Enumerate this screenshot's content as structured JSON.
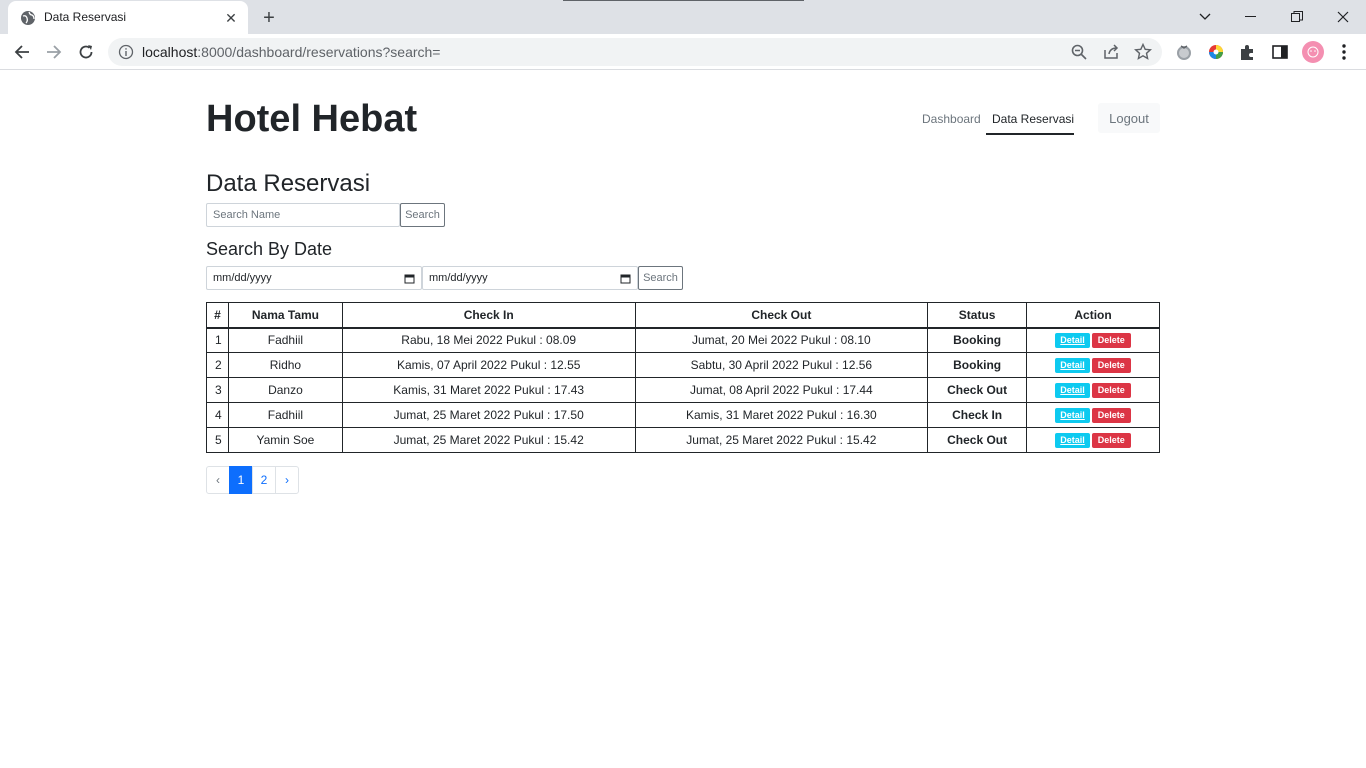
{
  "browser": {
    "tab_title": "Data Reservasi",
    "url_host": "localhost",
    "url_path": ":8000/dashboard/reservations?search="
  },
  "page": {
    "brand": "Hotel Hebat",
    "nav": {
      "dashboard": "Dashboard",
      "reservations": "Data Reservasi",
      "logout": "Logout"
    },
    "heading": "Data Reservasi",
    "search": {
      "placeholder": "Search Name",
      "button": "Search"
    },
    "date_heading": "Search By Date",
    "date_search": {
      "from_placeholder": "mm/dd/yyyy",
      "to_placeholder": "mm/dd/yyyy",
      "button": "Search"
    },
    "table": {
      "headers": [
        "#",
        "Nama Tamu",
        "Check In",
        "Check Out",
        "Status",
        "Action"
      ],
      "rows": [
        {
          "no": "1",
          "name": "Fadhiil",
          "check_in": "Rabu, 18 Mei 2022 Pukul : 08.09",
          "check_out": "Jumat, 20 Mei 2022 Pukul : 08.10",
          "status": "Booking"
        },
        {
          "no": "2",
          "name": "Ridho",
          "check_in": "Kamis, 07 April 2022 Pukul : 12.55",
          "check_out": "Sabtu, 30 April 2022 Pukul : 12.56",
          "status": "Booking"
        },
        {
          "no": "3",
          "name": "Danzo",
          "check_in": "Kamis, 31 Maret 2022 Pukul : 17.43",
          "check_out": "Jumat, 08 April 2022 Pukul : 17.44",
          "status": "Check Out"
        },
        {
          "no": "4",
          "name": "Fadhiil",
          "check_in": "Jumat, 25 Maret 2022 Pukul : 17.50",
          "check_out": "Kamis, 31 Maret 2022 Pukul : 16.30",
          "status": "Check In"
        },
        {
          "no": "5",
          "name": "Yamin Soe",
          "check_in": "Jumat, 25 Maret 2022 Pukul : 15.42",
          "check_out": "Jumat, 25 Maret 2022 Pukul : 15.42",
          "status": "Check Out"
        }
      ],
      "detail_label": "Detail",
      "delete_label": "Delete"
    },
    "pagination": {
      "prev": "‹",
      "pages": [
        "1",
        "2"
      ],
      "next": "›",
      "current": "1"
    }
  },
  "colors": {
    "primary": "#0d6efd",
    "info": "#0dcaf0",
    "danger": "#dc3545"
  }
}
